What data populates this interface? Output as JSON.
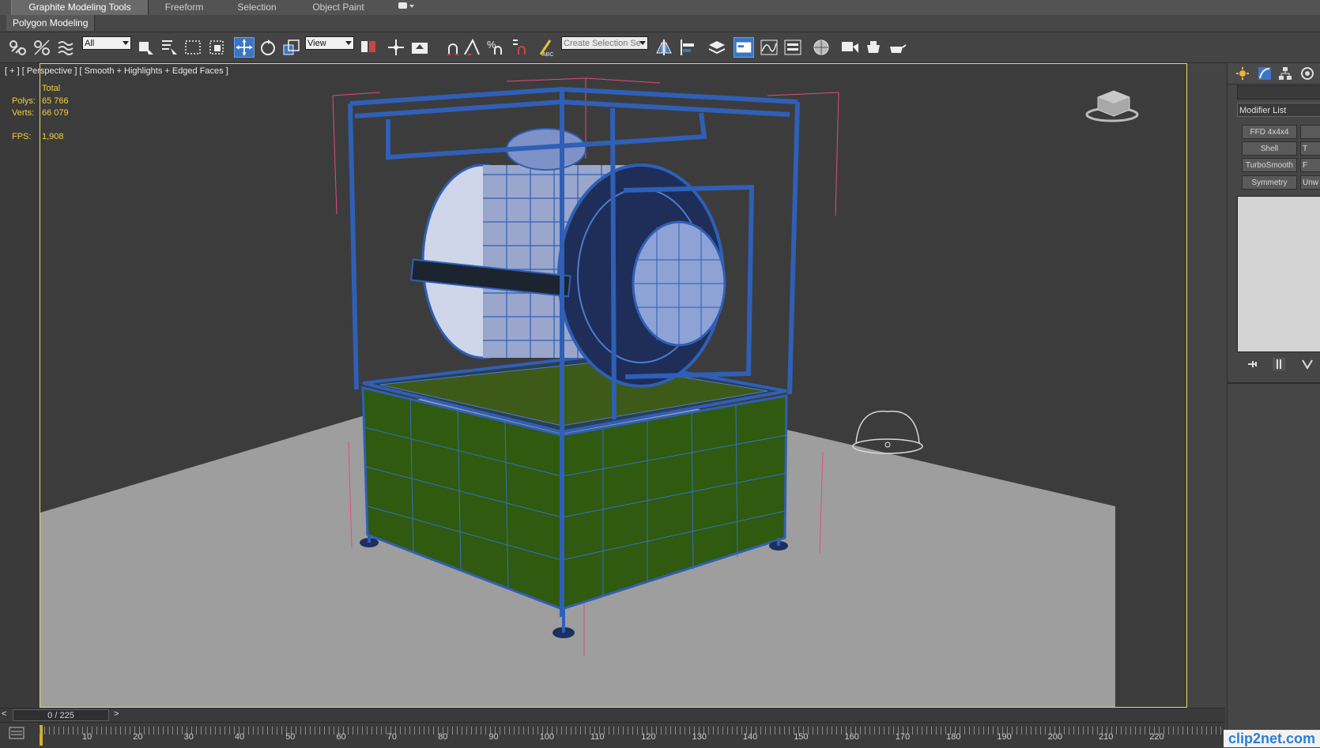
{
  "ribbon": {
    "tabs": [
      {
        "label": "Graphite Modeling Tools",
        "active": true
      },
      {
        "label": "Freeform",
        "active": false
      },
      {
        "label": "Selection",
        "active": false
      },
      {
        "label": "Object Paint",
        "active": false
      }
    ],
    "sub_tab": "Polygon Modeling"
  },
  "toolbar": {
    "selection_filter": "All",
    "reference_coord": "View",
    "named_selection_placeholder": "Create Selection Se",
    "snap_3d_label": "3",
    "percent_snap_label": "%"
  },
  "viewport": {
    "label": "[ + ] [ Perspective ] [ Smooth + Highlights + Edged Faces ]",
    "stats": {
      "total_label": "Total",
      "polys_label": "Polys:",
      "polys_value": "65 766",
      "verts_label": "Verts:",
      "verts_value": "66 079",
      "fps_label": "FPS:",
      "fps_value": "1,908"
    }
  },
  "command_panel": {
    "modifier_list": "Modifier List",
    "modifier_buttons": [
      "FFD 4x4x4",
      "Shell",
      "TurboSmooth",
      "Symmetry"
    ],
    "modifier_buttons_right": [
      "",
      "T",
      "F",
      "Unw"
    ]
  },
  "time_slider": {
    "position": "0 / 225",
    "prev": "<",
    "next": ">"
  },
  "timeline": {
    "ticks": [
      "10",
      "20",
      "30",
      "40",
      "50",
      "60",
      "70",
      "80",
      "90",
      "100",
      "110",
      "120",
      "130",
      "140",
      "150",
      "160",
      "170",
      "180",
      "190",
      "200",
      "210",
      "220"
    ]
  },
  "watermark": "clip2net.com",
  "colors": {
    "viewport_border": "#e6dc5a",
    "wire_blue": "#2f5fb6",
    "panel_green": "#2f5a0f",
    "stat_yellow": "#f2d03a"
  }
}
